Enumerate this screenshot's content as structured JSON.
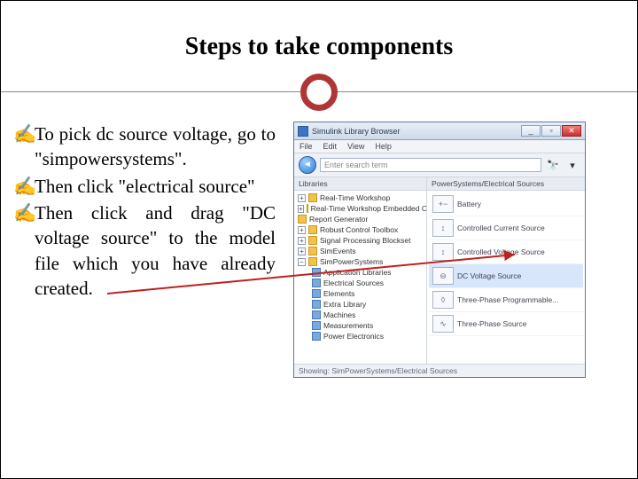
{
  "title": "Steps to take components",
  "bullets": [
    "To pick dc source voltage, go to \"simpowersystems\".",
    "Then click \"electrical source\"",
    "Then click and drag \"DC voltage source\" to the model file which you have already created."
  ],
  "browser": {
    "window_title": "Simulink Library Browser",
    "menu": [
      "File",
      "Edit",
      "View",
      "Help"
    ],
    "search_placeholder": "Enter search term",
    "left_header": "Libraries",
    "right_header": "PowerSystems/Electrical Sources",
    "tree": [
      "Real-Time Workshop",
      "Real-Time Workshop Embedded Code",
      "Report Generator",
      "Robust Control Toolbox",
      "Signal Processing Blockset",
      "SimEvents",
      "SimPowerSystems"
    ],
    "subtree": [
      "Application Libraries",
      "Electrical Sources",
      "Elements",
      "Extra Library",
      "Machines",
      "Measurements",
      "Power Electronics"
    ],
    "right_items": [
      {
        "icon": "+−",
        "label": "Battery"
      },
      {
        "icon": "↕",
        "label": "Controlled Current Source"
      },
      {
        "icon": "↕",
        "label": "Controlled Voltage Source"
      },
      {
        "icon": "⊖",
        "label": "DC Voltage Source"
      },
      {
        "icon": "◊",
        "label": "Three-Phase Programmable..."
      },
      {
        "icon": "∿",
        "label": "Three-Phase Source"
      }
    ],
    "status": "Showing: SimPowerSystems/Electrical Sources"
  }
}
